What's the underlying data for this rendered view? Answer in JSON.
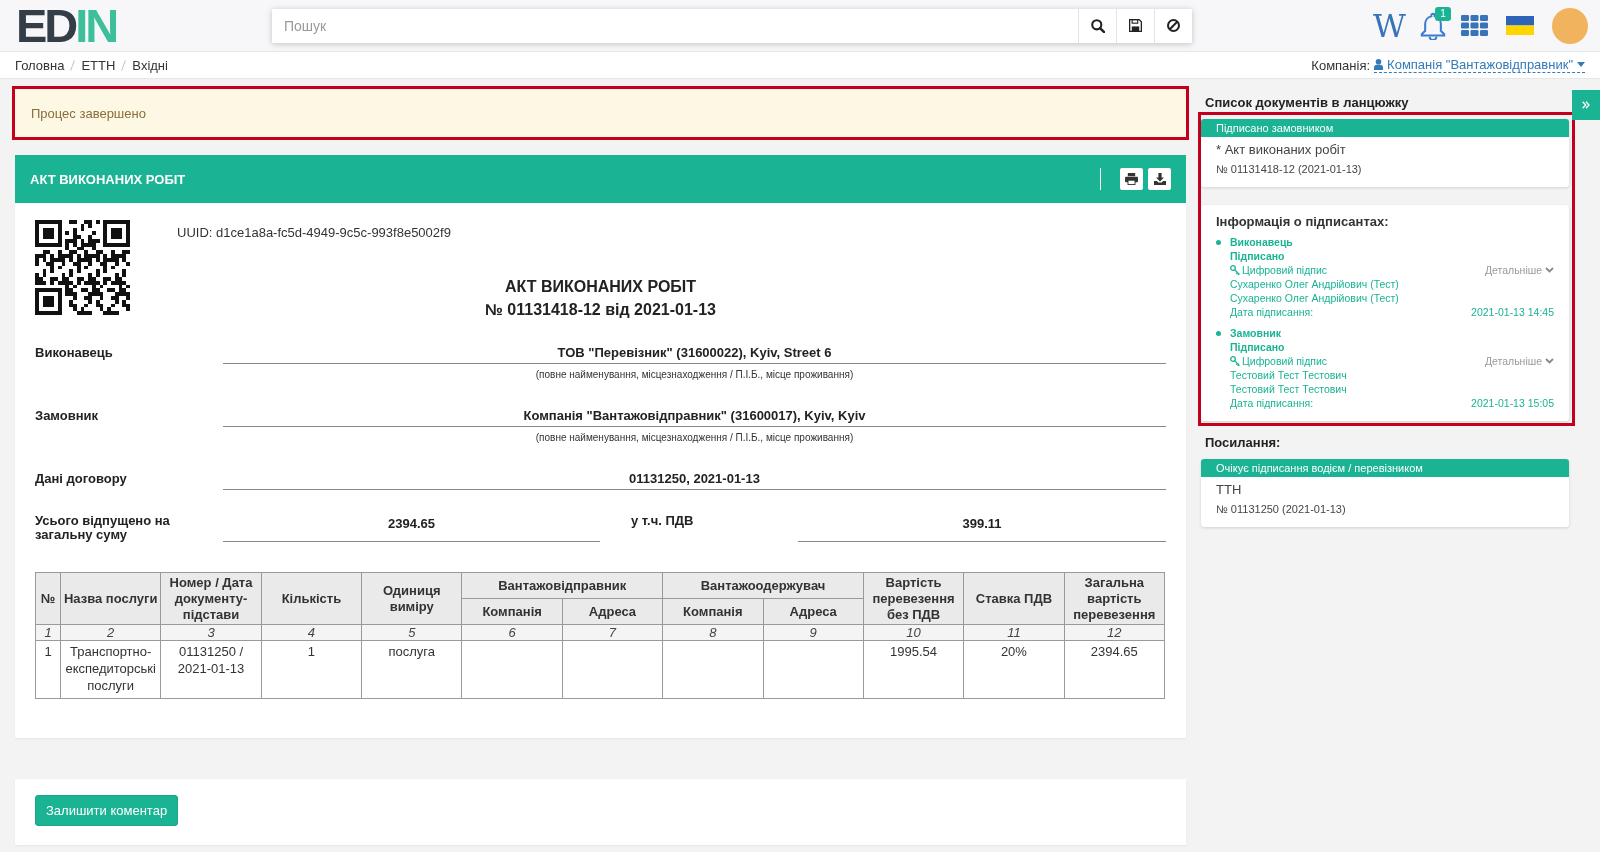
{
  "header": {
    "logo": {
      "dark": "ED",
      "accent": "IN"
    },
    "search": {
      "placeholder": "Пошук"
    },
    "wiki": "W",
    "notifications": "1"
  },
  "breadcrumb": [
    {
      "label": "Головна"
    },
    {
      "label": "ЕТТН"
    },
    {
      "label": "Вхідні"
    }
  ],
  "company": {
    "label": "Компанія:",
    "value": "Компанія \"Вантажовідправник\""
  },
  "alert": {
    "text": "Процес завершено",
    "highlighted": true
  },
  "document": {
    "header_title": "АКТ ВИКОНАНИХ РОБІТ",
    "uuid": "UUID: d1ce1a8a-fc5d-4949-9c5c-993f8e5002f9",
    "title": "АКТ ВИКОНАНИХ РОБІТ",
    "number": "№ 01131418-12 від 2021-01-13",
    "fields": [
      {
        "kind": "single",
        "label": "Виконавець",
        "value": "ТОВ \"Перевізник\" (31600022), Kyiv, Street 6",
        "hint": "(повне найменування, місцезнаходження / П.І.Б., місце проживання)"
      },
      {
        "kind": "single",
        "label": "Замовник",
        "value": "Компанія \"Вантажовідправник\" (31600017), Kyiv, Kyiv",
        "hint": "(повне найменування, місцезнаходження / П.І.Б., місце проживання)"
      },
      {
        "kind": "single",
        "label": "Дані договору",
        "value": "01131250, 2021-01-13"
      },
      {
        "kind": "pair",
        "label": "Усього відпущено на загальну суму",
        "value": "2394.65",
        "label_2": "у т.ч. ПДВ",
        "value_2": "399.11"
      }
    ],
    "table": {
      "columns": [
        {
          "kind": "single",
          "label": "№"
        },
        {
          "kind": "single",
          "label": "Назва послуги"
        },
        {
          "kind": "single",
          "label": "Номер / Дата документу-підстави"
        },
        {
          "kind": "single",
          "label": "Кількість"
        },
        {
          "kind": "single",
          "label": "Одиниця виміру"
        },
        {
          "kind": "sub",
          "group": "Вантажовідправник",
          "label": "Компанія"
        },
        {
          "kind": "sub",
          "label": "Адреса"
        },
        {
          "kind": "sub",
          "group": "Вантажоодержувач",
          "label": "Компанія"
        },
        {
          "kind": "sub",
          "label": "Адреса"
        },
        {
          "kind": "single",
          "label": "Вартість перевезення без ПДВ"
        },
        {
          "kind": "single",
          "label": "Ставка ПДВ"
        },
        {
          "kind": "single",
          "label": "Загальна вартість перевезення"
        }
      ],
      "column_numbers": [
        "1",
        "2",
        "3",
        "4",
        "5",
        "6",
        "7",
        "8",
        "9",
        "10",
        "11",
        "12"
      ],
      "rows": [
        [
          "1",
          "Транспортно-експедиторські послуги",
          "01131250 / 2021-01-13",
          "1",
          "послуга",
          "",
          "",
          "",
          "",
          "1995.54",
          "20%",
          "2394.65"
        ]
      ]
    }
  },
  "comment_button": "Залишити коментар",
  "chain": {
    "title": "Список документів в ланцюжку",
    "highlighted": true,
    "documents": [
      {
        "status": "Підписано замовником",
        "name": "* Акт виконаних робіт",
        "number": "№ 01131418-12 (2021-01-13)"
      }
    ],
    "signers_title": "Інформація о підписантах:",
    "signers": [
      {
        "role": "Виконавець",
        "status": "Підписано",
        "signature": "Цифровий підпис",
        "details": "Детальніше",
        "names": [
          "Сухаренко Олег Андрійович (Тест)",
          "Сухаренко Олег Андрійович (Тест)"
        ],
        "date_label": "Дата підписання:",
        "date": "2021-01-13 14:45"
      },
      {
        "role": "Замовник",
        "status": "Підписано",
        "signature": "Цифровий підпис",
        "details": "Детальніше",
        "names": [
          "Тестовий Тест Тестович",
          "Тестовий Тест Тестович"
        ],
        "date_label": "Дата підписання:",
        "date": "2021-01-13 15:05"
      }
    ]
  },
  "links": {
    "title": "Посилання:",
    "documents": [
      {
        "status": "Очікує підписання водієм / перевізником",
        "name": "ТТН",
        "number": "№ 01131250 (2021-01-13)"
      }
    ]
  }
}
